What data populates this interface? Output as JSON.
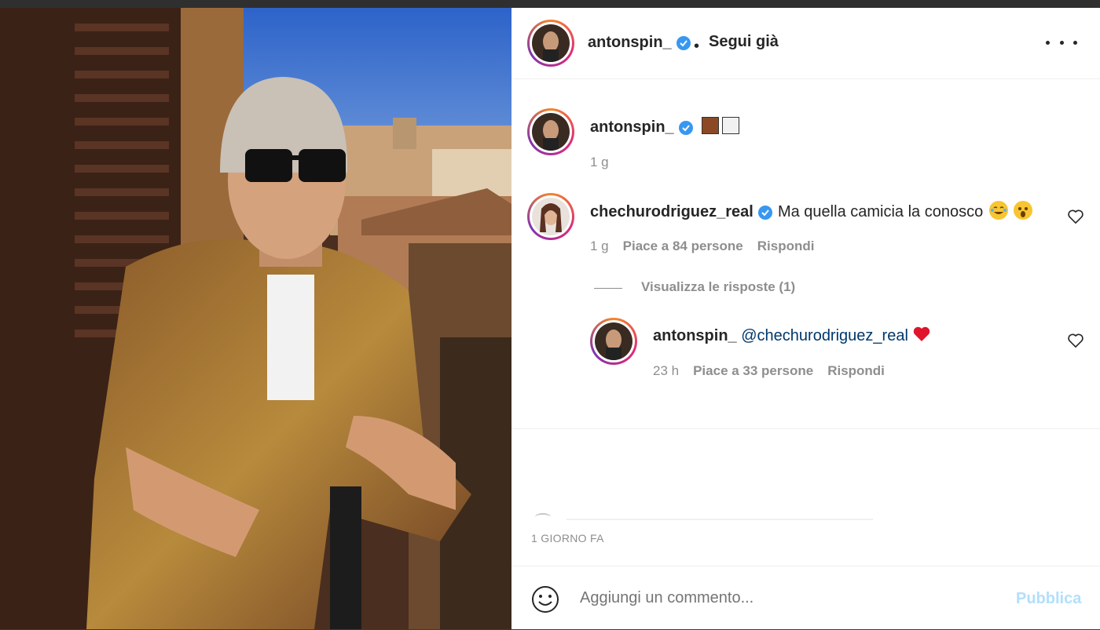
{
  "post_header": {
    "username": "antonspin_",
    "separator": "•",
    "follow_status": "Segui già"
  },
  "caption": {
    "username": "antonspin_",
    "emojis": [
      "brown-square",
      "white-square"
    ],
    "time": "1 g"
  },
  "comments": [
    {
      "username": "chechurodriguez_real",
      "text": "Ma quella camicia la conosco",
      "emojis": [
        "tears-of-joy-emoji",
        "astonished-emoji"
      ],
      "time": "1 g",
      "likes": "Piace a 84 persone",
      "reply_label": "Rispondi",
      "view_replies": "Visualizza le risposte (1)"
    },
    {
      "username": "antonspin_",
      "mention": "@chechurodriguez_real",
      "emojis": [
        "red-heart-emoji"
      ],
      "time": "23 h",
      "likes": "Piace a 33 persone",
      "reply_label": "Rispondi"
    }
  ],
  "post_date": "1 GIORNO FA",
  "comment_box": {
    "placeholder": "Aggiungi un commento...",
    "submit_label": "Pubblica"
  },
  "colors": {
    "verified": "#3897f0",
    "link": "#00376b",
    "muted": "#8e8e8e",
    "submit_disabled": "#b2dffc",
    "heart": "#ed4956"
  }
}
